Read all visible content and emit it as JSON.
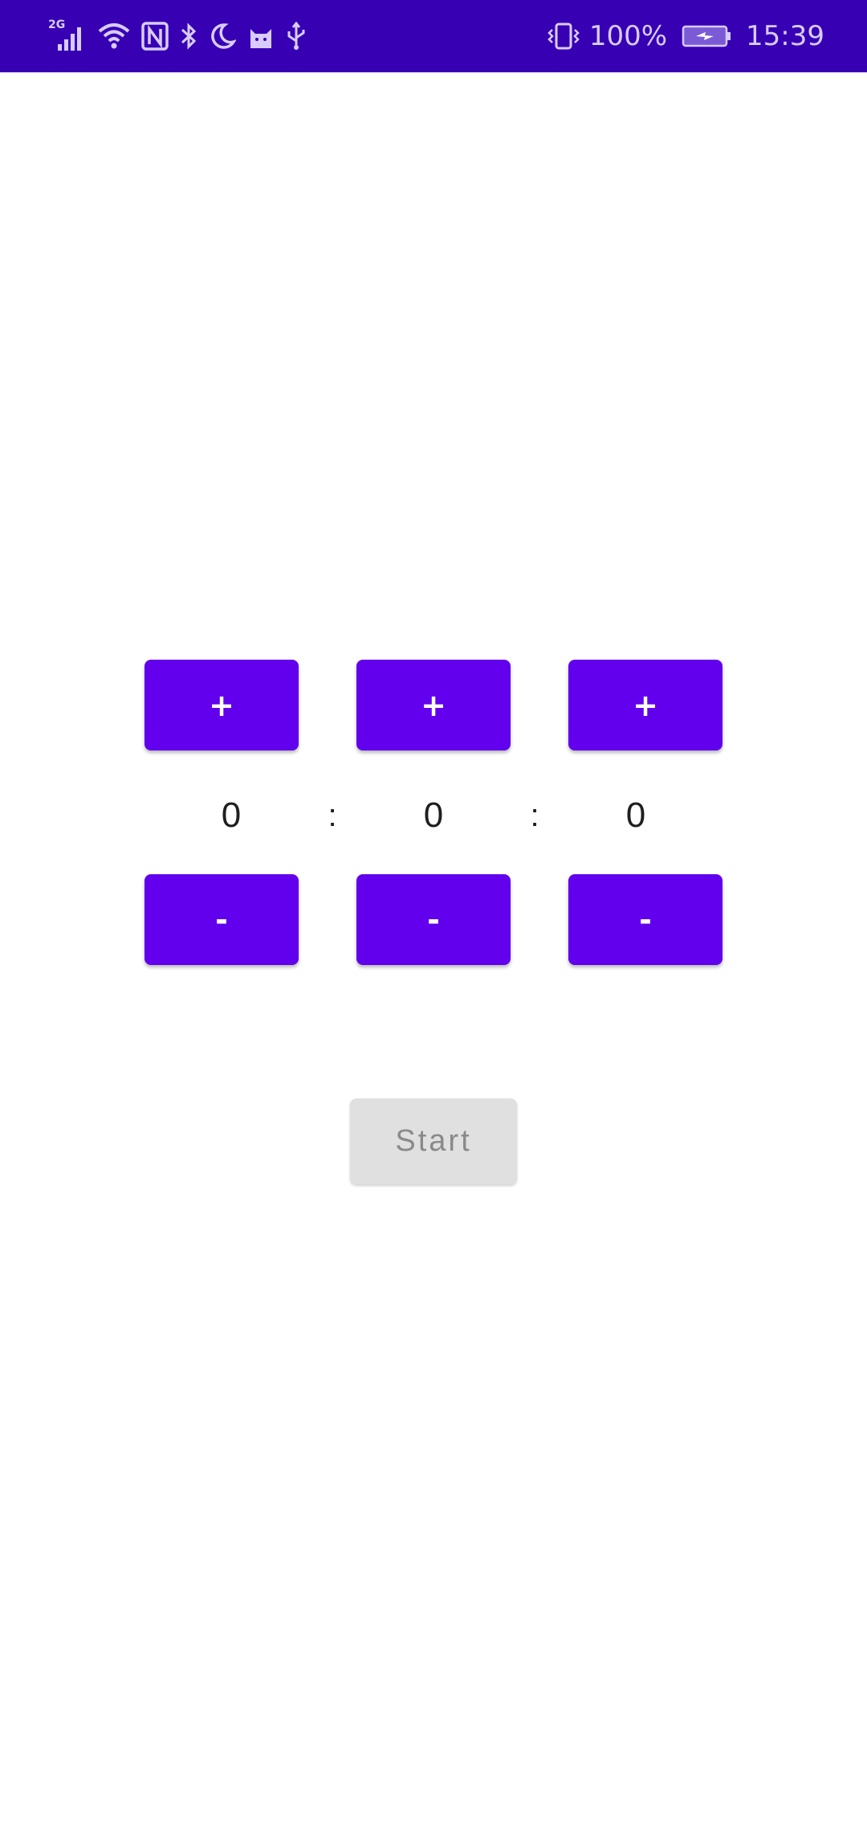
{
  "status_bar": {
    "network_type": "2G",
    "battery_percent": "100%",
    "time": "15:39",
    "left_icons": [
      "signal-icon",
      "wifi-icon",
      "nfc-icon",
      "bluetooth-icon",
      "do-not-disturb-moon-icon",
      "cat-app-icon",
      "usb-icon"
    ],
    "right_icons": [
      "vibrate-icon",
      "battery-charging-icon"
    ]
  },
  "timer": {
    "hours": "0",
    "minutes": "0",
    "seconds": "0",
    "separator": ":",
    "increment_label": "+",
    "decrement_label": "-"
  },
  "start_button": {
    "label": "Start",
    "enabled": false
  },
  "colors": {
    "status_bar": "#3700B3",
    "primary": "#6200EE",
    "disabled_button": "#E0E0E0",
    "disabled_text": "#8A8A8A"
  }
}
